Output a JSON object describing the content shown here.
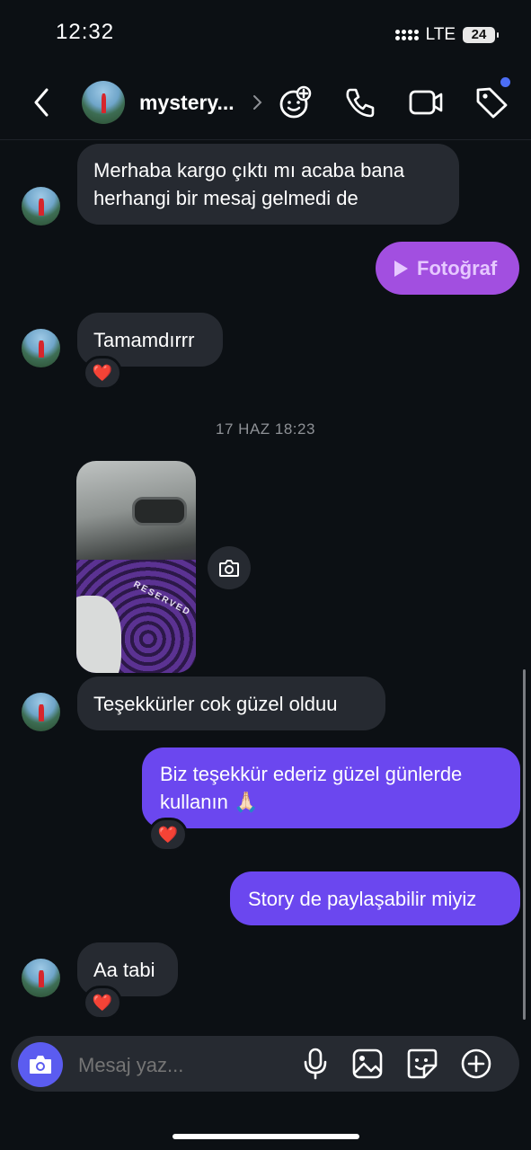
{
  "status_bar": {
    "time": "12:32",
    "network": "LTE",
    "battery": "24"
  },
  "header": {
    "username": "mystery..."
  },
  "messages": [
    {
      "from": "them",
      "text": "Merhaba kargo çıktı mı acaba bana herhangi bir mesaj gelmedi de"
    },
    {
      "from": "me",
      "type": "attachment",
      "text": "Fotoğraf"
    },
    {
      "from": "them",
      "text": "Tamamdırrr",
      "reaction": "❤️"
    },
    {
      "type": "date",
      "text": "17 HAZ 18:23"
    },
    {
      "from": "them",
      "type": "photo",
      "photo_caption": "RESERVED"
    },
    {
      "from": "them",
      "text": "Teşekkürler cok güzel olduu"
    },
    {
      "from": "me",
      "text": "Biz teşekkür ederiz güzel günlerde kullanın 🙏🏻",
      "reaction": "❤️"
    },
    {
      "from": "me",
      "text": "Story de paylaşabilir miyiz"
    },
    {
      "from": "them",
      "text": "Aa tabi",
      "reaction": "❤️"
    }
  ],
  "composer": {
    "placeholder": "Mesaj yaz..."
  },
  "colors": {
    "background": "#0c1014",
    "incoming_bubble": "#262a31",
    "outgoing_bubble": "#6b47ef",
    "attachment_bubble": "#a24fe0",
    "heart": "#ff2d3b",
    "notification_dot": "#4c6ef5"
  }
}
